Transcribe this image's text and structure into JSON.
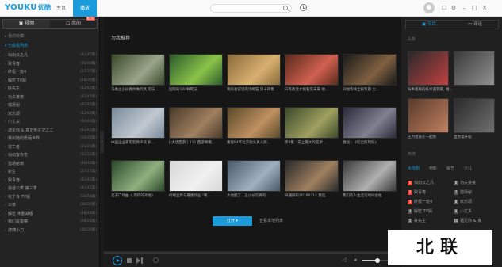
{
  "app": {
    "logo_text": "YOUKU",
    "logo_cn": "优酷",
    "nav_tabs": [
      "主页",
      "播放"
    ],
    "active_nav": 1
  },
  "sidebar": {
    "tabs": [
      "视频",
      "我的"
    ],
    "new_badge": "NEW",
    "section_label": "我的收藏",
    "section2_label": "已收看列表",
    "items": [
      {
        "label": "仙剑云之凡",
        "meta": "(41/45集)",
        "hl": false
      },
      {
        "label": "致青春",
        "meta": "(40/40集)",
        "hl": false
      },
      {
        "label": "终极一班4",
        "meta": "(37/37集)",
        "hl": false
      },
      {
        "label": "解密 TV版",
        "meta": "(36/36集)",
        "hl": false
      },
      {
        "label": "好先生",
        "meta": "(42/42集)",
        "hl": false
      },
      {
        "label": "功夫婆婆",
        "meta": "(41/41集)",
        "hl": false
      },
      {
        "label": "猎场秘",
        "meta": "(45/45集)",
        "hl": false
      },
      {
        "label": "欢乐颂",
        "meta": "(42/42集)",
        "hl": false
      },
      {
        "label": "小丈夫",
        "meta": "(40/40集)",
        "hl": false
      },
      {
        "label": "遇见你 & 真正男子汉之二",
        "meta": "(41/41集)",
        "hl": false
      },
      {
        "label": "我和她的奇葩世界",
        "meta": "(20/20集)",
        "hl": false
      },
      {
        "label": "逃亡者",
        "meta": "(23/23集)",
        "hl": false
      },
      {
        "label": "仙剑客传奇",
        "meta": "(32/32集)",
        "hl": false
      },
      {
        "label": "猎场秘籍",
        "meta": "(40/40集)",
        "hl": false
      },
      {
        "label": "新生",
        "meta": "(27/27集)",
        "hl": false
      },
      {
        "label": "致青春",
        "meta": "(42/42集)",
        "hl": false
      },
      {
        "label": "最佳公寓 第三季",
        "meta": "(41/41集)",
        "hl": false
      },
      {
        "label": "花千骨 TV版",
        "meta": "(58/58集)",
        "hl": false
      },
      {
        "label": "三体",
        "meta": "(30/30集)",
        "hl": false
      },
      {
        "label": "解密 未删减版",
        "meta": "(48/48集)",
        "hl": false
      },
      {
        "label": "我们是警察",
        "meta": "(28/28集)",
        "hl": false
      },
      {
        "label": "虎啸小刀",
        "meta": "(30/30集)",
        "hl": false
      }
    ]
  },
  "center": {
    "title": "为我推荐",
    "cards": [
      {
        "caption": "马秀兰小伙教你做玩具 可乐...",
        "c1": "#3b4a2a",
        "c2": "#9aa48a"
      },
      {
        "caption": "国际的100种死法",
        "c1": "#2a5a2a",
        "c2": "#8bc34a"
      },
      {
        "caption": "我的会说话的汤姆猫 第十四集...",
        "c1": "#8a6a3a",
        "c2": "#d8b070"
      },
      {
        "caption": "只有改变才能看见未来 他...",
        "c1": "#5a2a1a",
        "c2": "#d06050"
      },
      {
        "caption": "同福客栈全剧专题 大...",
        "c1": "#1a1a1a",
        "c2": "#806040"
      },
      {
        "caption": "中国企业家电影原声读 如...",
        "c1": "#7a8a9a",
        "c2": "#c0c8d0"
      },
      {
        "caption": "[ 大话西游 ] 111 西游降魔...",
        "c1": "#4a3a2a",
        "c2": "#a08060"
      },
      {
        "caption": "重现94年北京街头真人版...",
        "c1": "#5a4a2a",
        "c2": "#c09060"
      },
      {
        "caption": "第8集 : 史上最大的空调...",
        "c1": "#3a4a2a",
        "c2": "#a0a060"
      },
      {
        "caption": "激战 : 《综出现列队》",
        "c1": "#2a2a3a",
        "c2": "#808090"
      },
      {
        "caption": "走子广场曲《 博得的幸福》",
        "c1": "#2a4a2a",
        "c2": "#90b080"
      },
      {
        "caption": "终端宣传与看图作业 \"暖...",
        "c1": "#d8d8d8",
        "c2": "#f0f0f0"
      },
      {
        "caption": "大地图了 , 这小伙写真的...",
        "c1": "#4a5a6a",
        "c2": "#a0b0c0"
      },
      {
        "caption": "早播解码20160714 我是...",
        "c1": "#2a2a2a",
        "c2": "#a08060"
      },
      {
        "caption": "我们的人生无论时间会给...",
        "c1": "#3a3a3a",
        "c2": "#b0b0b0"
      }
    ],
    "open_button": "打开 ▾",
    "local_list": "查看本地列表"
  },
  "right": {
    "tabs": [
      "节目",
      "评论"
    ],
    "rank_label": "头条",
    "rank_label2": "热榜",
    "thumbs": [
      {
        "caption": "技术都服的技术遇到家, 相...",
        "c1": "#2a2a2a",
        "c2": "#c04040"
      },
      {
        "caption": "",
        "c1": "#3a3a3a",
        "c2": "#909090"
      },
      {
        "caption": "王力者爱在一起啦",
        "c1": "#5a3a2a",
        "c2": "#c08060"
      },
      {
        "caption": "直觉电开站",
        "c1": "#2a2a2a",
        "c2": "#707070"
      }
    ],
    "categories": [
      "大陆剧",
      "电影",
      "综艺",
      "少儿"
    ],
    "active_category": 0,
    "rank_items": [
      {
        "no": "1",
        "label": "仙剑云之凡",
        "red": true
      },
      {
        "no": "2",
        "label": "致青春",
        "red": true
      },
      {
        "no": "3",
        "label": "终极一班4",
        "red": true
      },
      {
        "no": "4",
        "label": "解密 TV版",
        "red": false
      },
      {
        "no": "5",
        "label": "好先生",
        "red": false
      },
      {
        "no": "6",
        "label": "功夫婆婆",
        "red": false
      },
      {
        "no": "7",
        "label": "猎场秘",
        "red": false
      },
      {
        "no": "8",
        "label": "欢乐颂",
        "red": false
      },
      {
        "no": "9",
        "label": "小丈夫",
        "red": false
      },
      {
        "no": "10",
        "label": "遇见你 & 真",
        "red": false
      }
    ]
  },
  "controls": {
    "volume_level": 0.55
  },
  "watermark": "北联"
}
